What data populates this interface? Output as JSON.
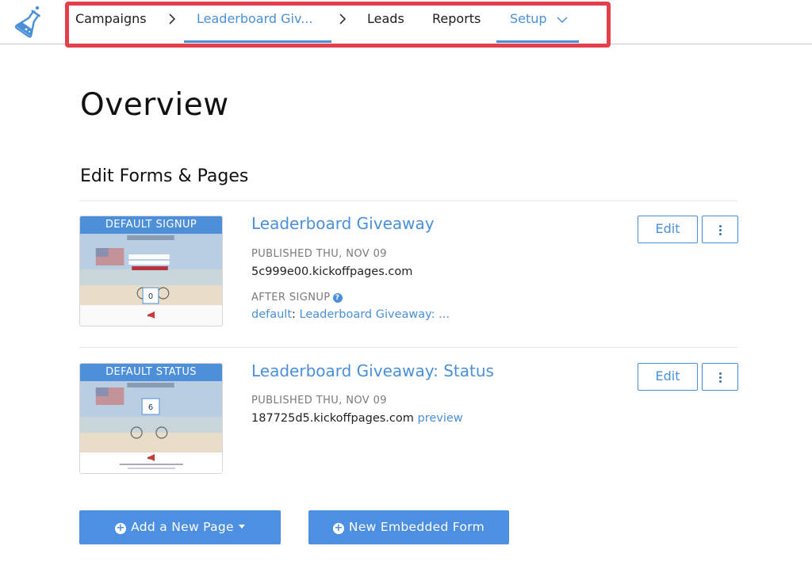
{
  "nav": {
    "items": [
      {
        "label": "Campaigns"
      },
      {
        "label": "Leaderboard Giv..."
      },
      {
        "label": "Leads"
      },
      {
        "label": "Reports"
      },
      {
        "label": "Setup"
      }
    ]
  },
  "page_title": "Overview",
  "section_title": "Edit Forms & Pages",
  "pages": [
    {
      "thumb_label": "DEFAULT SIGNUP",
      "title": "Leaderboard Giveaway",
      "published_label": "PUBLISHED THU, NOV 09",
      "domain": "5c999e00.kickoffpages.com",
      "after_signup_label": "AFTER SIGNUP",
      "after_signup_key": "default",
      "after_signup_sep": ":",
      "after_signup_value": "Leaderboard Giveaway: ...",
      "edit_label": "Edit"
    },
    {
      "thumb_label": "DEFAULT STATUS",
      "title": "Leaderboard Giveaway: Status",
      "published_label": "PUBLISHED THU, NOV 09",
      "domain": "187725d5.kickoffpages.com",
      "preview_label": "preview",
      "edit_label": "Edit"
    }
  ],
  "actions": {
    "add_page": "Add a New Page",
    "new_form": "New Embedded Form"
  },
  "colors": {
    "accent": "#4a90d9",
    "highlight": "#e3404b",
    "primary_button": "#4d8fe0"
  },
  "icons": [
    "flask-icon",
    "chevron-right-icon",
    "chevron-down-icon",
    "help-icon",
    "more-vertical-icon",
    "plus-circle-icon",
    "caret-down-icon"
  ]
}
